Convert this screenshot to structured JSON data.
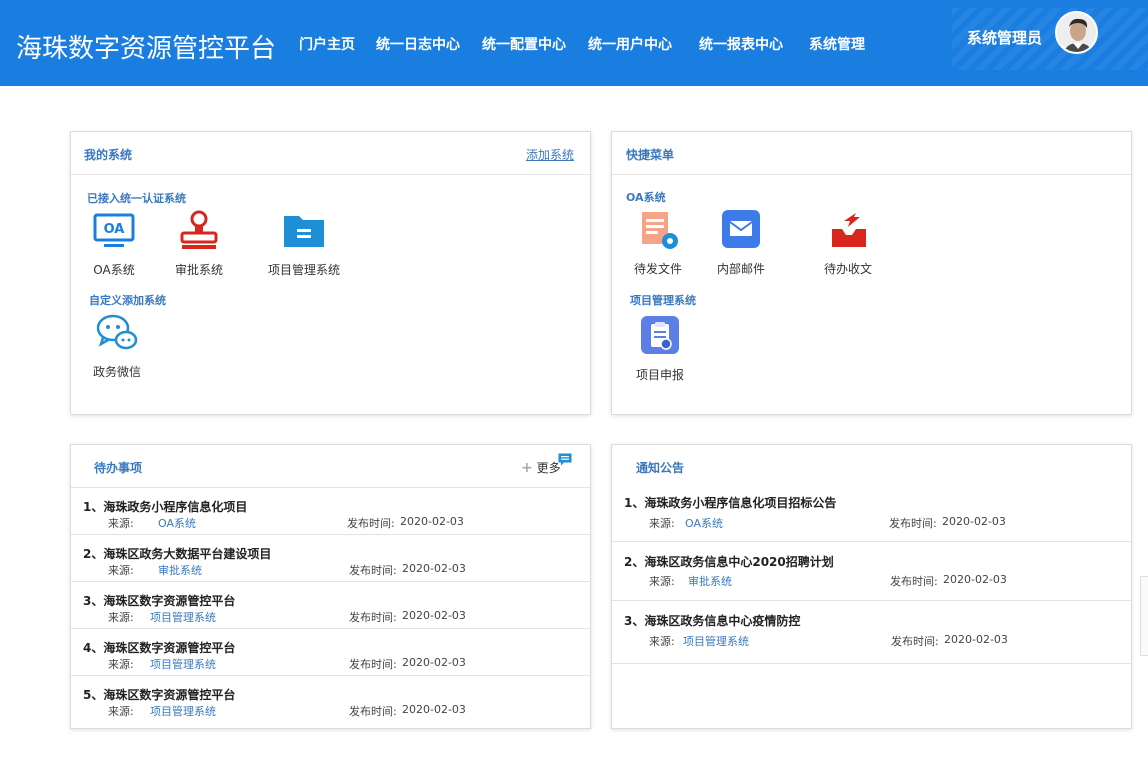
{
  "header": {
    "title": "海珠数字资源管控平台",
    "nav": [
      "门户主页",
      "统一日志中心",
      "统一配置中心",
      "统一用户中心",
      "统一报表中心",
      "系统管理"
    ],
    "user_name": "系统管理员"
  },
  "my_systems": {
    "title": "我的系统",
    "add_link": "添加系统",
    "section_auth": "已接入统一认证系统",
    "auth_apps": [
      {
        "label": "OA系统",
        "icon": "oa-icon"
      },
      {
        "label": "审批系统",
        "icon": "stamp-icon"
      },
      {
        "label": "项目管理系统",
        "icon": "folder-icon"
      }
    ],
    "section_custom": "自定义添加系统",
    "custom_apps": [
      {
        "label": "政务微信",
        "icon": "wechat-icon"
      }
    ]
  },
  "quick_menu": {
    "title": "快捷菜单",
    "section_oa": "OA系统",
    "oa_items": [
      {
        "label": "待发文件",
        "icon": "document-gear-icon"
      },
      {
        "label": "内部邮件",
        "icon": "mail-icon"
      },
      {
        "label": "待办收文",
        "icon": "inbox-icon"
      }
    ],
    "section_project": "项目管理系统",
    "project_items": [
      {
        "label": "项目申报",
        "icon": "clipboard-icon"
      }
    ]
  },
  "todo": {
    "title": "待办事项",
    "more_label": "更多",
    "source_label": "来源:",
    "time_label": "发布时间:",
    "items": [
      {
        "title": "1、海珠政务小程序信息化项目",
        "source": "OA系统",
        "date": "2020-02-03"
      },
      {
        "title": "2、海珠区政务大数据平台建设项目",
        "source": "审批系统",
        "date": "2020-02-03"
      },
      {
        "title": "3、海珠区数字资源管控平台",
        "source": "项目管理系统",
        "date": "2020-02-03"
      },
      {
        "title": "4、海珠区数字资源管控平台",
        "source": "项目管理系统",
        "date": "2020-02-03"
      },
      {
        "title": "5、海珠区数字资源管控平台",
        "source": "项目管理系统",
        "date": "2020-02-03"
      }
    ]
  },
  "notice": {
    "title": "通知公告",
    "source_label": "来源:",
    "time_label": "发布时间:",
    "items": [
      {
        "title": "1、海珠政务小程序信息化项目招标公告",
        "source": "OA系统",
        "date": "2020-02-03"
      },
      {
        "title": "2、海珠区政务信息中心2020招聘计划",
        "source": "审批系统",
        "date": "2020-02-03"
      },
      {
        "title": "3、海珠区政务信息中心疫情防控",
        "source": "项目管理系统",
        "date": "2020-02-03"
      }
    ]
  },
  "colors": {
    "header_bg": "#1a7de0",
    "accent_text": "#3a78c0",
    "oa_icon": "#1a7de0",
    "stamp_icon": "#d9261c",
    "folder_icon": "#1e8fd6",
    "mail_icon": "#3d7be8",
    "clipboard_icon": "#5b7fe6"
  }
}
